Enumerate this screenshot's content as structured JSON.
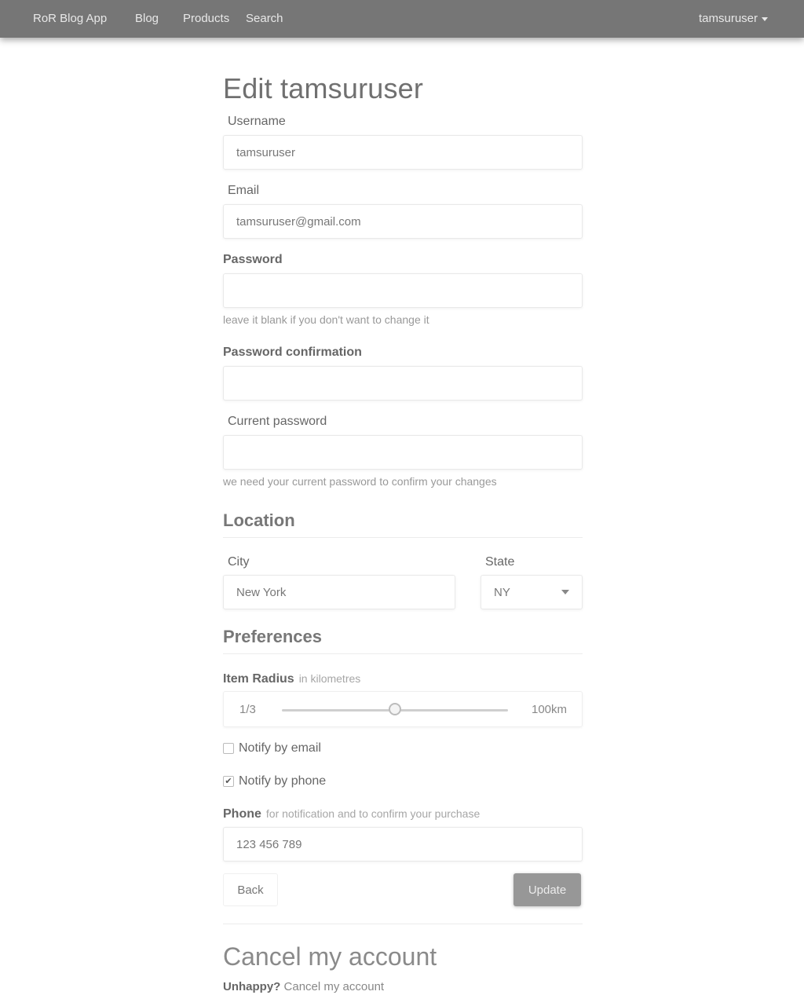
{
  "nav": {
    "brand": "RoR Blog App",
    "links": [
      "Blog",
      "Products",
      "Search"
    ],
    "user": "tamsuruser"
  },
  "page": {
    "title": "Edit tamsuruser"
  },
  "form": {
    "username": {
      "label": "Username",
      "value": "tamsuruser"
    },
    "email": {
      "label": "Email",
      "value": "tamsuruser@gmail.com"
    },
    "password": {
      "label": "Password",
      "value": "",
      "help": "leave it blank if you don't want to change it"
    },
    "password_confirmation": {
      "label": "Password confirmation",
      "value": ""
    },
    "current_password": {
      "label": "Current password",
      "value": "",
      "help": "we need your current password to confirm your changes"
    }
  },
  "location": {
    "heading": "Location",
    "city": {
      "label": "City",
      "value": "New York"
    },
    "state": {
      "label": "State",
      "value": "NY"
    }
  },
  "preferences": {
    "heading": "Preferences",
    "item_radius": {
      "label": "Item Radius",
      "hint": "in kilometres",
      "min_label": "1/3",
      "max_label": "100km",
      "value_fraction": 0.5
    },
    "notify_email": {
      "label": "Notify by email",
      "checked": false
    },
    "notify_phone": {
      "label": "Notify by phone",
      "checked": true
    },
    "phone": {
      "label": "Phone",
      "hint": "for notification and to confirm your purchase",
      "value": "123 456 789"
    }
  },
  "actions": {
    "back": "Back",
    "update": "Update"
  },
  "cancel": {
    "title": "Cancel my account",
    "question": "Unhappy?",
    "link": "Cancel my account"
  },
  "colors": {
    "navbar": "#767676",
    "primary_button": "#979797"
  }
}
